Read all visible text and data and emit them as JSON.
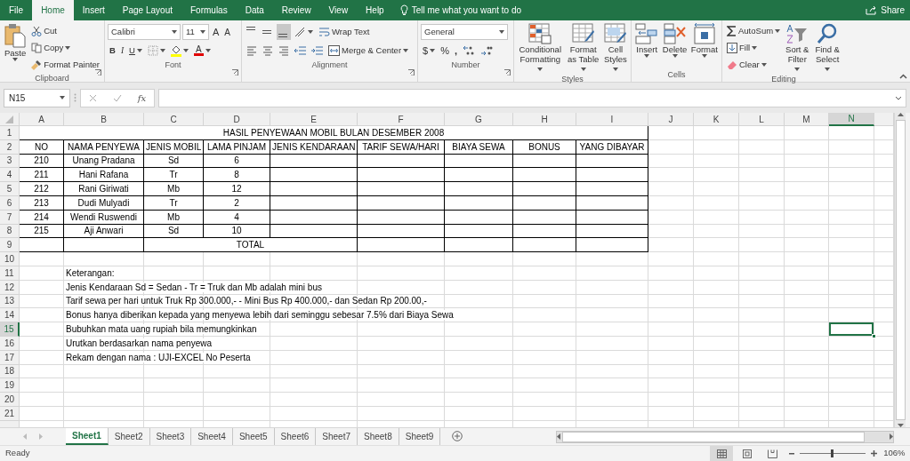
{
  "ribbon_tabs": [
    {
      "label": "File",
      "selected": false
    },
    {
      "label": "Home",
      "selected": true
    },
    {
      "label": "Insert",
      "selected": false
    },
    {
      "label": "Page Layout",
      "selected": false
    },
    {
      "label": "Formulas",
      "selected": false
    },
    {
      "label": "Data",
      "selected": false
    },
    {
      "label": "Review",
      "selected": false
    },
    {
      "label": "View",
      "selected": false
    },
    {
      "label": "Help",
      "selected": false
    }
  ],
  "tell_me": "Tell me what you want to do",
  "share": "Share",
  "clipboard": {
    "paste": "Paste",
    "cut": "Cut",
    "copy": "Copy",
    "format_painter": "Format Painter",
    "label": "Clipboard"
  },
  "font": {
    "name": "Calibri",
    "size": "11",
    "grow": "A",
    "shrink": "A",
    "bold": "B",
    "italic": "I",
    "underline": "U",
    "font_color": "A",
    "label": "Font"
  },
  "alignment": {
    "vertical_align_buttons": [
      {
        "selected": false
      },
      {
        "selected": false
      },
      {
        "selected": true
      }
    ],
    "wrap_text": "Wrap Text",
    "merge_center": "Merge & Center",
    "label": "Alignment"
  },
  "number": {
    "format": "General",
    "currency": "$",
    "percent": "%",
    "comma": ",",
    "label": "Number"
  },
  "styles": {
    "conditional_formatting": "Conditional Formatting",
    "format_as_table": "Format as Table",
    "cell_styles": "Cell Styles",
    "label": "Styles"
  },
  "cells": {
    "insert": "Insert",
    "delete": "Delete",
    "format": "Format",
    "label": "Cells"
  },
  "editing": {
    "autosum": "AutoSum",
    "fill": "Fill",
    "clear": "Clear",
    "sort_filter": "Sort & Filter",
    "find_select": "Find & Select",
    "label": "Editing"
  },
  "formula_bar": {
    "name_box": "N15",
    "function_symbol": "fx"
  },
  "columns": [
    {
      "label": "A",
      "selected": false
    },
    {
      "label": "B",
      "selected": false
    },
    {
      "label": "C",
      "selected": false
    },
    {
      "label": "D",
      "selected": false
    },
    {
      "label": "E",
      "selected": false
    },
    {
      "label": "F",
      "selected": false
    },
    {
      "label": "G",
      "selected": false
    },
    {
      "label": "H",
      "selected": false
    },
    {
      "label": "I",
      "selected": false
    },
    {
      "label": "J",
      "selected": false
    },
    {
      "label": "K",
      "selected": false
    },
    {
      "label": "L",
      "selected": false
    },
    {
      "label": "M",
      "selected": false
    },
    {
      "label": "N",
      "selected": true
    }
  ],
  "rows": [
    {
      "label": "1",
      "selected": false
    },
    {
      "label": "2",
      "selected": false
    },
    {
      "label": "3",
      "selected": false
    },
    {
      "label": "4",
      "selected": false
    },
    {
      "label": "5",
      "selected": false
    },
    {
      "label": "6",
      "selected": false
    },
    {
      "label": "7",
      "selected": false
    },
    {
      "label": "8",
      "selected": false
    },
    {
      "label": "9",
      "selected": false
    },
    {
      "label": "10",
      "selected": false
    },
    {
      "label": "11",
      "selected": false
    },
    {
      "label": "12",
      "selected": false
    },
    {
      "label": "13",
      "selected": false
    },
    {
      "label": "14",
      "selected": false
    },
    {
      "label": "15",
      "selected": true
    },
    {
      "label": "16",
      "selected": false
    },
    {
      "label": "17",
      "selected": false
    },
    {
      "label": "18",
      "selected": false
    },
    {
      "label": "19",
      "selected": false
    },
    {
      "label": "20",
      "selected": false
    },
    {
      "label": "21",
      "selected": false
    }
  ],
  "sheet": {
    "title": "HASIL PENYEWAAN MOBIL BULAN DESEMBER 2008",
    "table": {
      "columns": [
        "NO",
        "NAMA PENYEWA",
        "JENIS MOBIL",
        "LAMA PINJAM",
        "JENIS KENDARAAN",
        "TARIF SEWA/HARI",
        "BIAYA SEWA",
        "BONUS",
        "YANG DIBAYAR"
      ],
      "rows": [
        [
          "210",
          "Unang Pradana",
          "Sd",
          "6"
        ],
        [
          "211",
          "Hani Rafana",
          "Tr",
          "8"
        ],
        [
          "212",
          "Rani Giriwati",
          "Mb",
          "12"
        ],
        [
          "213",
          "Dudi Mulyadi",
          "Tr",
          "2"
        ],
        [
          "214",
          "Wendi Ruswendi",
          "Mb",
          "4"
        ],
        [
          "215",
          "Aji Anwari",
          "Sd",
          "10"
        ]
      ],
      "total_label": "TOTAL"
    },
    "notes": [
      "Keterangan:",
      "Jenis Kendaraan Sd = Sedan - Tr = Truk dan Mb adalah mini bus",
      "Tarif sewa per hari untuk Truk Rp 300.000,- - Mini Bus Rp 400.000,- dan Sedan Rp 200.00,-",
      "Bonus hanya diberikan kepada yang menyewa lebih dari seminggu sebesar 7.5% dari Biaya Sewa",
      "Bubuhkan mata uang rupiah bila memungkinkan",
      "Urutkan berdasarkan nama penyewa",
      "Rekam dengan nama : UJI-EXCEL No Peserta"
    ]
  },
  "sheet_tabs": [
    {
      "label": "Sheet1",
      "selected": true
    },
    {
      "label": "Sheet2",
      "selected": false
    },
    {
      "label": "Sheet3",
      "selected": false
    },
    {
      "label": "Sheet4",
      "selected": false
    },
    {
      "label": "Sheet5",
      "selected": false
    },
    {
      "label": "Sheet6",
      "selected": false
    },
    {
      "label": "Sheet7",
      "selected": false
    },
    {
      "label": "Sheet8",
      "selected": false
    },
    {
      "label": "Sheet9",
      "selected": false
    }
  ],
  "status": "Ready",
  "zoom": {
    "level": 0.5,
    "reading": "106%"
  }
}
